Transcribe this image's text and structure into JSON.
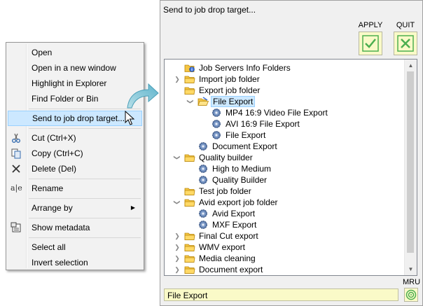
{
  "context_menu": {
    "items": [
      {
        "label": "Open"
      },
      {
        "label": "Open in a new window"
      },
      {
        "label": "Highlight in Explorer"
      },
      {
        "label": "Find Folder or Bin"
      },
      {
        "label": "Send to job drop target..."
      },
      {
        "label": "Cut (Ctrl+X)",
        "icon": "scissors-icon"
      },
      {
        "label": "Copy (Ctrl+C)",
        "icon": "copy-icon"
      },
      {
        "label": "Delete (Del)",
        "icon": "delete-icon"
      },
      {
        "label": "Rename",
        "icon": "rename-icon"
      },
      {
        "label": "Arrange by",
        "icon": "submenu-arrow-icon"
      },
      {
        "label": "Show metadata",
        "icon": "metadata-icon"
      },
      {
        "label": "Select all"
      },
      {
        "label": "Invert selection"
      }
    ],
    "highlighted": "Send to job drop target..."
  },
  "dialog": {
    "title": "Send to job drop target...",
    "apply_label": "APPLY",
    "quit_label": "QUIT",
    "mru_label": "MRU",
    "status_value": "File Export",
    "colors": {
      "button_bg": "#fafac8",
      "check_green": "#4caf50",
      "selection": "#cce8ff"
    },
    "tree": [
      {
        "label": "Job Servers Info Folders",
        "icon": "folder-info-icon",
        "toggle": ""
      },
      {
        "label": "Import job folder",
        "icon": "folder-icon",
        "toggle": "collapsed"
      },
      {
        "label": "Export job folder",
        "icon": "folder-icon",
        "toggle": ""
      },
      {
        "label": "File Export",
        "icon": "folder-open-icon",
        "toggle": "expanded",
        "selected": true
      },
      {
        "label": "MP4 16:9 Video File Export",
        "icon": "gear-icon",
        "toggle": ""
      },
      {
        "label": "AVI 16:9 File Export",
        "icon": "gear-icon",
        "toggle": ""
      },
      {
        "label": "File Export",
        "icon": "gear-icon",
        "toggle": ""
      },
      {
        "label": "Document Export",
        "icon": "gear-icon",
        "toggle": ""
      },
      {
        "label": "Quality builder",
        "icon": "folder-icon",
        "toggle": "expanded"
      },
      {
        "label": "High to Medium",
        "icon": "gear-icon",
        "toggle": ""
      },
      {
        "label": "Quality Builder",
        "icon": "gear-icon",
        "toggle": ""
      },
      {
        "label": "Test job folder",
        "icon": "folder-icon",
        "toggle": ""
      },
      {
        "label": "Avid export job folder",
        "icon": "folder-icon",
        "toggle": "expanded"
      },
      {
        "label": "Avid Export",
        "icon": "gear-icon",
        "toggle": ""
      },
      {
        "label": "MXF Export",
        "icon": "gear-icon",
        "toggle": ""
      },
      {
        "label": "Final Cut export",
        "icon": "folder-icon",
        "toggle": "collapsed"
      },
      {
        "label": "WMV export",
        "icon": "folder-icon",
        "toggle": "collapsed"
      },
      {
        "label": "Media cleaning",
        "icon": "folder-icon",
        "toggle": "collapsed"
      },
      {
        "label": "Document export",
        "icon": "folder-icon",
        "toggle": "collapsed"
      }
    ]
  }
}
